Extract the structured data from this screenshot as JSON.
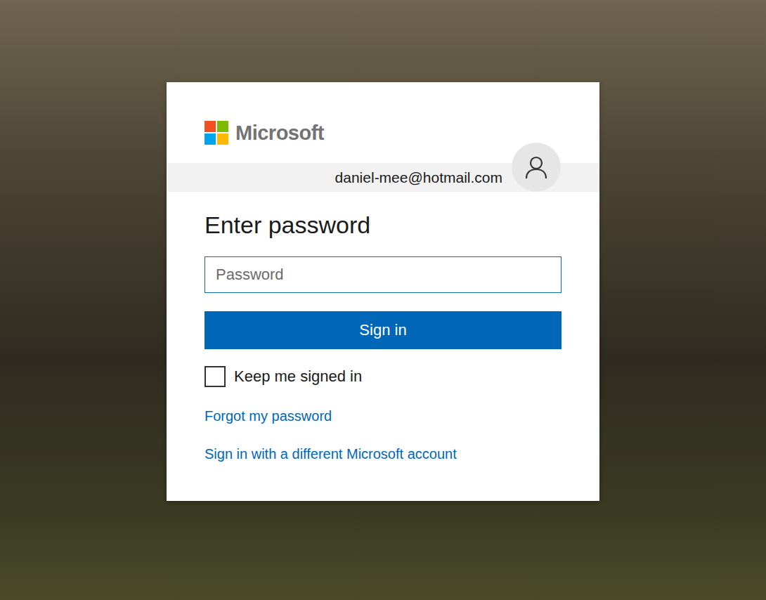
{
  "logo": {
    "text": "Microsoft"
  },
  "account": {
    "email": "daniel-mee@hotmail.com"
  },
  "heading": "Enter password",
  "password": {
    "placeholder": "Password"
  },
  "sign_in_button": "Sign in",
  "keep_signed_in": {
    "label": "Keep me signed in",
    "checked": false
  },
  "links": [
    "Forgot my password",
    "Sign in with a different Microsoft account"
  ]
}
